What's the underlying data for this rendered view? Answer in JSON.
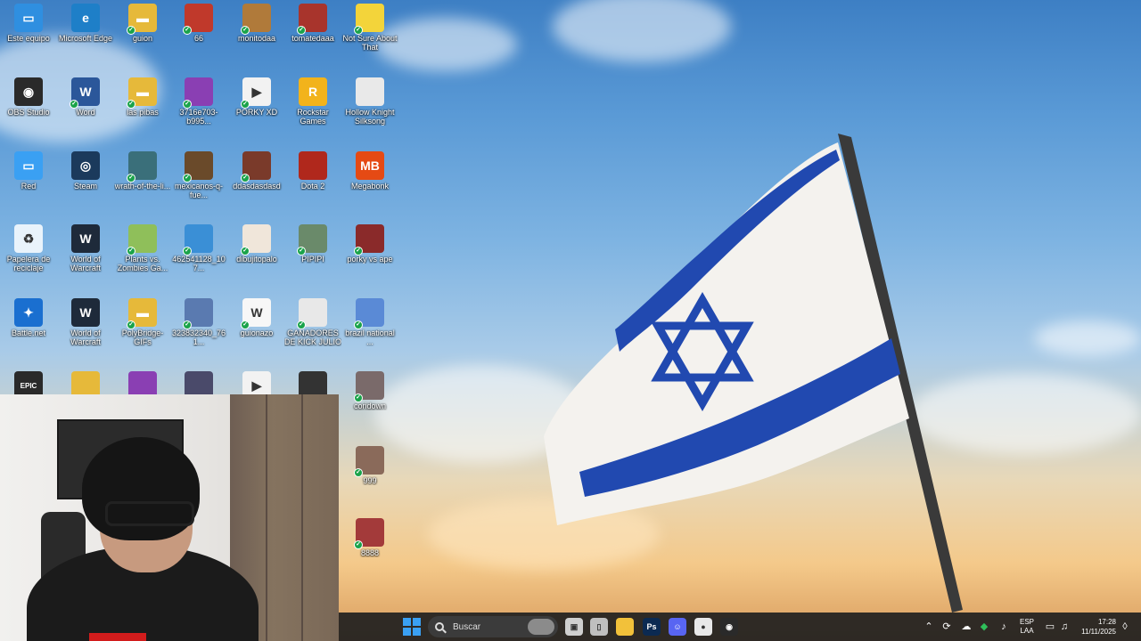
{
  "desktop": {
    "icons": [
      {
        "id": "este-equipo",
        "label": "Este equipo",
        "color": "#2f8fe0",
        "glyph": "▭",
        "sync": false
      },
      {
        "id": "edge",
        "label": "Microsoft Edge",
        "color": "#1e7fc8",
        "glyph": "e",
        "sync": false
      },
      {
        "id": "guion",
        "label": "guion",
        "color": "#e6b93a",
        "glyph": "▬",
        "sync": true
      },
      {
        "id": "66",
        "label": "66",
        "color": "#c0392b",
        "glyph": "",
        "sync": true
      },
      {
        "id": "monitodaa",
        "label": "monitodaa",
        "color": "#b07a3a",
        "glyph": "",
        "sync": true
      },
      {
        "id": "tomatedaaa",
        "label": "tomatedaaa",
        "color": "#a8342c",
        "glyph": "",
        "sync": true
      },
      {
        "id": "not-sure",
        "label": "Not Sure About That",
        "color": "#f3d43a",
        "glyph": "",
        "sync": true
      },
      {
        "id": "obs",
        "label": "OBS Studio",
        "color": "#2a2a2a",
        "glyph": "◉",
        "sync": false
      },
      {
        "id": "word",
        "label": "Word",
        "color": "#2b579a",
        "glyph": "W",
        "sync": true
      },
      {
        "id": "las-pibas",
        "label": "las pibas",
        "color": "#e6b93a",
        "glyph": "▬",
        "sync": true
      },
      {
        "id": "f3716",
        "label": "3716e703-b995...",
        "color": "#8a3fb3",
        "glyph": "",
        "sync": true
      },
      {
        "id": "porky-xd",
        "label": "PORKY XD",
        "color": "#f2f2f2",
        "glyph": "▶",
        "sync": true
      },
      {
        "id": "rockstar",
        "label": "Rockstar Games Launcher",
        "color": "#f2b31b",
        "glyph": "R",
        "sync": false
      },
      {
        "id": "hollow",
        "label": "Hollow Knight Silksong",
        "color": "#e9e9e9",
        "glyph": "",
        "sync": false
      },
      {
        "id": "red",
        "label": "Red",
        "color": "#3aa0f3",
        "glyph": "▭",
        "sync": false
      },
      {
        "id": "steam",
        "label": "Steam",
        "color": "#1b3a5c",
        "glyph": "◎",
        "sync": false
      },
      {
        "id": "wrath",
        "label": "wrath-of-the-li...",
        "color": "#3a6f7a",
        "glyph": "",
        "sync": true
      },
      {
        "id": "mexicanos",
        "label": "mexicanos-q-fue...",
        "color": "#6a4a2a",
        "glyph": "",
        "sync": true
      },
      {
        "id": "ddasdasdasd",
        "label": "ddasdasdasd",
        "color": "#7a3a2a",
        "glyph": "",
        "sync": true
      },
      {
        "id": "dota",
        "label": "Dota 2",
        "color": "#b0281c",
        "glyph": "",
        "sync": false
      },
      {
        "id": "megabonk",
        "label": "Megabonk",
        "color": "#e54a14",
        "glyph": "MB",
        "sync": false
      },
      {
        "id": "papelera",
        "label": "Papelera de reciclaje",
        "color": "#e9f3fb",
        "glyph": "♻",
        "sync": false
      },
      {
        "id": "wow-classic",
        "label": "World of Warcraft Classic",
        "color": "#1e2a3a",
        "glyph": "W",
        "sync": false
      },
      {
        "id": "pvz",
        "label": "Plants vs. Zombies Ga...",
        "color": "#8fbf5a",
        "glyph": "",
        "sync": true
      },
      {
        "id": "f462",
        "label": "462541128_107...",
        "color": "#3a8fd6",
        "glyph": "",
        "sync": true
      },
      {
        "id": "dibujitopalo",
        "label": "dibujitopalo",
        "color": "#f0e6da",
        "glyph": "",
        "sync": true
      },
      {
        "id": "pipipi",
        "label": "PIPIPI",
        "color": "#6a8a6a",
        "glyph": "",
        "sync": true
      },
      {
        "id": "porky-vs",
        "label": "porky vs ape",
        "color": "#8a2a2a",
        "glyph": "",
        "sync": true
      },
      {
        "id": "battlenet",
        "label": "Battle.net",
        "color": "#1a6fd0",
        "glyph": "✦",
        "sync": false
      },
      {
        "id": "wow",
        "label": "World of Warcraft",
        "color": "#1e2a3a",
        "glyph": "W",
        "sync": false
      },
      {
        "id": "polybridge",
        "label": "PolyBridge-GIFs",
        "color": "#e6b93a",
        "glyph": "▬",
        "sync": true
      },
      {
        "id": "f3238",
        "label": "323832340_761...",
        "color": "#5a7ab0",
        "glyph": "",
        "sync": true
      },
      {
        "id": "guionazo",
        "label": "guionazo",
        "color": "#f7f7f7",
        "glyph": "W",
        "sync": true
      },
      {
        "id": "ganadores",
        "label": "GANADORES DE KICK JULIO",
        "color": "#e8e8e8",
        "glyph": "",
        "sync": true
      },
      {
        "id": "brazil",
        "label": "brazil national ...",
        "color": "#5a8ad6",
        "glyph": "",
        "sync": true
      },
      {
        "id": "epic",
        "label": "",
        "color": "#2a2a2a",
        "glyph": "EPIC",
        "sync": false
      },
      {
        "id": "partial-1",
        "label": "",
        "color": "#e6b93a",
        "glyph": "",
        "sync": false
      },
      {
        "id": "partial-2",
        "label": "",
        "color": "#8a3fb3",
        "glyph": "",
        "sync": false
      },
      {
        "id": "partial-3",
        "label": "",
        "color": "#4a4a6a",
        "glyph": "",
        "sync": false
      },
      {
        "id": "partial-4",
        "label": "",
        "color": "#f2f2f2",
        "glyph": "▶",
        "sync": false
      },
      {
        "id": "partial-5",
        "label": "",
        "color": "#333333",
        "glyph": "",
        "sync": false
      },
      {
        "id": "coridown",
        "label": "coridown",
        "color": "#7a6a6a",
        "glyph": "",
        "sync": true
      },
      {
        "id": "999",
        "label": "999",
        "color": "#8a6a5a",
        "glyph": "",
        "sync": true
      },
      {
        "id": "8888",
        "label": "8888",
        "color": "#a33a3a",
        "glyph": "",
        "sync": true
      }
    ]
  },
  "taskbar": {
    "search_placeholder": "Buscar",
    "apps": [
      {
        "id": "task-view",
        "color": "#cfcfcf",
        "glyph": "▣"
      },
      {
        "id": "phone",
        "color": "#bfbfbf",
        "glyph": "▯"
      },
      {
        "id": "explorer",
        "color": "#f2c13a",
        "glyph": ""
      },
      {
        "id": "photoshop",
        "color": "#0b2a52",
        "glyph": "Ps"
      },
      {
        "id": "discord",
        "color": "#5865f2",
        "glyph": "☺"
      },
      {
        "id": "chrome",
        "color": "#e8e8e8",
        "glyph": "●"
      },
      {
        "id": "obs-app",
        "color": "#2a2a2a",
        "glyph": "◉"
      }
    ],
    "lang_top": "ESP",
    "lang_bottom": "LAA",
    "time": "17:28",
    "date": "11/11/2025"
  }
}
